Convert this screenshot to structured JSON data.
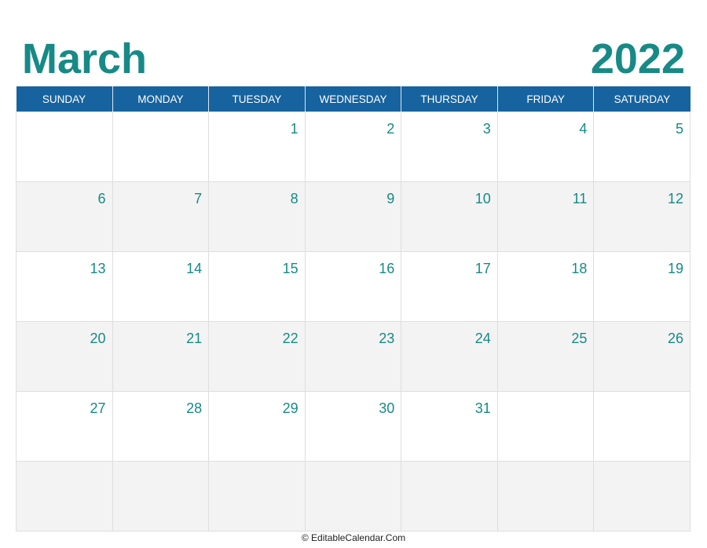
{
  "header": {
    "month": "March",
    "year": "2022"
  },
  "weekdays": [
    "SUNDAY",
    "MONDAY",
    "TUESDAY",
    "WEDNESDAY",
    "THURSDAY",
    "FRIDAY",
    "SATURDAY"
  ],
  "weeks": [
    [
      "",
      "",
      "1",
      "2",
      "3",
      "4",
      "5"
    ],
    [
      "6",
      "7",
      "8",
      "9",
      "10",
      "11",
      "12"
    ],
    [
      "13",
      "14",
      "15",
      "16",
      "17",
      "18",
      "19"
    ],
    [
      "20",
      "21",
      "22",
      "23",
      "24",
      "25",
      "26"
    ],
    [
      "27",
      "28",
      "29",
      "30",
      "31",
      "",
      ""
    ],
    [
      "",
      "",
      "",
      "",
      "",
      "",
      ""
    ]
  ],
  "footer": {
    "text": "© EditableCalendar.Com"
  },
  "colors": {
    "title": "#178a86",
    "header_bg": "#16639f",
    "date_text": "#178a86",
    "alt_row": "#f3f3f3"
  }
}
